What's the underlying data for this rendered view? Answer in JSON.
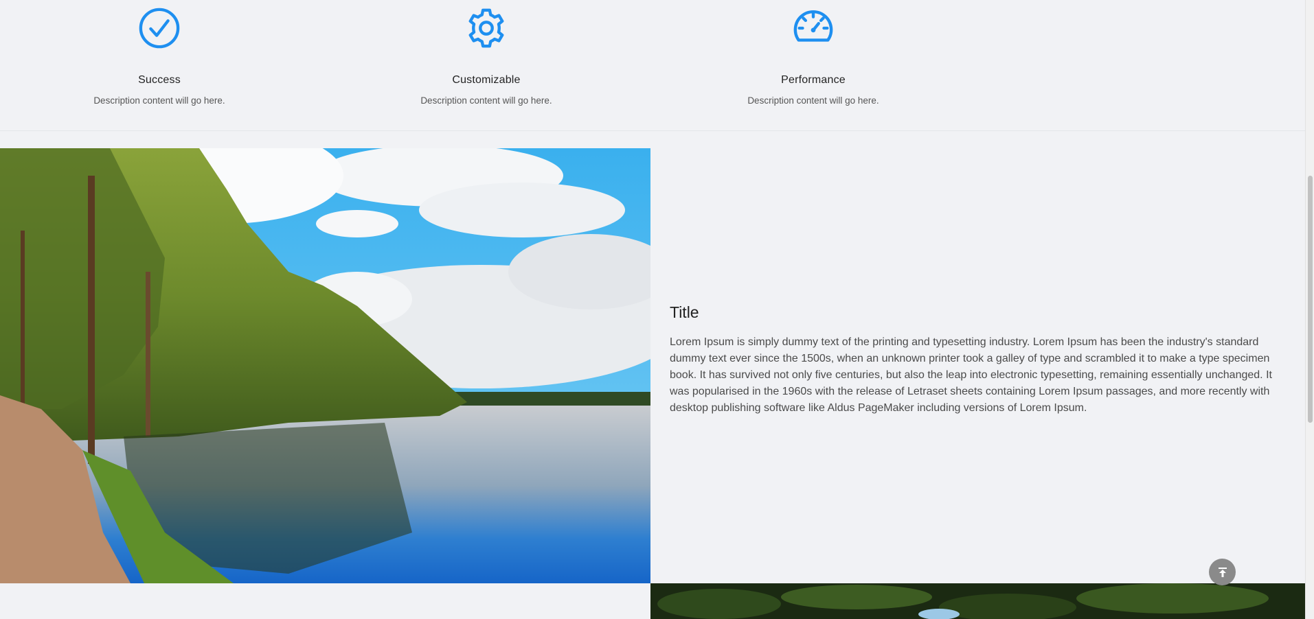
{
  "features": [
    {
      "icon": "check-circle-icon",
      "title": "Success",
      "description": "Description content will go here."
    },
    {
      "icon": "gear-icon",
      "title": "Customizable",
      "description": "Description content will go here."
    },
    {
      "icon": "speedometer-icon",
      "title": "Performance",
      "description": "Description content will go here."
    }
  ],
  "section": {
    "title": "Title",
    "body": "Lorem Ipsum is simply dummy text of the printing and typesetting industry. Lorem Ipsum has been the industry's standard dummy text ever since  the 1500s, when an unknown printer took a galley of type and scrambled it  to make a type specimen book. It has survived not only five centuries, but also the leap into electronic typesetting, remaining essentially unchanged. It was popularised in the 1960s with the release of Letraset sheets  containing Lorem Ipsum passages, and more recently with desktop publishing  software like Aldus PageMaker including versions of Lorem Ipsum."
  },
  "images": {
    "main": "lake-forest-photo",
    "secondary": "foliage-photo"
  },
  "back_to_top": {
    "icon": "arrow-up-to-top-icon"
  },
  "colors": {
    "accent": "#1e8ff0",
    "background": "#f1f2f5",
    "button": "#8a8a8a"
  }
}
